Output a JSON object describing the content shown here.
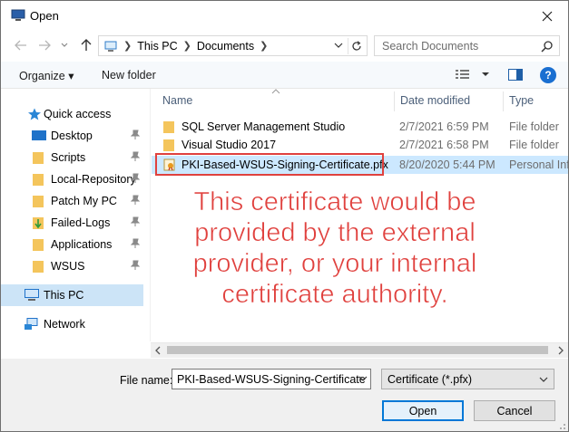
{
  "window": {
    "title": "Open"
  },
  "address": {
    "crumbs": [
      "This PC",
      "Documents"
    ],
    "search_placeholder": "Search Documents"
  },
  "toolbar": {
    "organize": "Organize ▾",
    "new_folder": "New folder"
  },
  "sidebar": {
    "items": [
      {
        "label": "Quick access",
        "icon": "star-icon"
      },
      {
        "label": "Desktop",
        "icon": "desktop-icon",
        "pinned": true
      },
      {
        "label": "Scripts",
        "icon": "folder-icon",
        "pinned": true
      },
      {
        "label": "Local-Repository",
        "icon": "folder-icon",
        "pinned": true
      },
      {
        "label": "Patch My PC",
        "icon": "folder-icon",
        "pinned": true
      },
      {
        "label": "Failed-Logs",
        "icon": "folder-icon",
        "pinned": true
      },
      {
        "label": "Applications",
        "icon": "folder-icon",
        "pinned": true
      },
      {
        "label": "WSUS",
        "icon": "folder-icon",
        "pinned": true
      },
      {
        "label": "This PC",
        "icon": "pc-icon",
        "selected": true
      },
      {
        "label": "Network",
        "icon": "network-icon"
      }
    ]
  },
  "columns": {
    "name": "Name",
    "date": "Date modified",
    "type": "Type"
  },
  "files": [
    {
      "name": "SQL Server Management Studio",
      "date": "2/7/2021 6:59 PM",
      "type": "File folder"
    },
    {
      "name": "Visual Studio 2017",
      "date": "2/7/2021 6:58 PM",
      "type": "File folder"
    },
    {
      "name": "PKI-Based-WSUS-Signing-Certificate.pfx",
      "date": "8/20/2020 5:44 PM",
      "type": "Personal Info"
    }
  ],
  "annotation": {
    "lines": [
      "This certificate would be",
      "provided by the external",
      "provider, or your internal",
      "certificate authority."
    ],
    "color": "#e0413e"
  },
  "bottom": {
    "file_name_label": "File name:",
    "file_name_value": "PKI-Based-WSUS-Signing-Certificate",
    "filter_value": "Certificate (*.pfx)",
    "open_label": "Open",
    "cancel_label": "Cancel"
  },
  "colors": {
    "accent": "#0078d7",
    "selection": "#cce8ff",
    "folder": "#f4c55c"
  }
}
